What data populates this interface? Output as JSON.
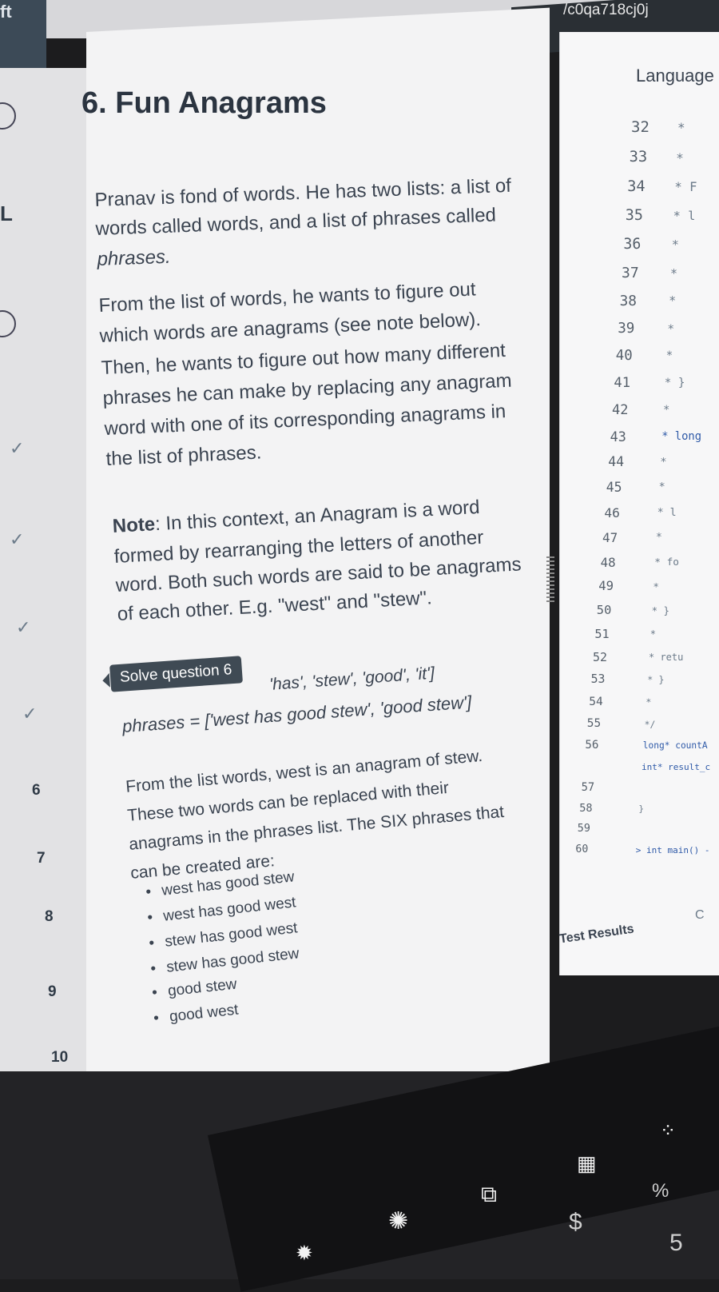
{
  "browser": {
    "tab_fragment": "ft",
    "url_fragment": "/c0qa718cj0j"
  },
  "left_nav": {
    "partial_letters": [
      "L"
    ],
    "items": [
      {
        "number": "6"
      },
      {
        "number": "7"
      },
      {
        "number": "8"
      },
      {
        "number": "9"
      },
      {
        "number": "10"
      }
    ],
    "completed_checks": [
      "✓",
      "✓",
      "✓",
      "✓"
    ]
  },
  "question": {
    "title": "6. Fun Anagrams",
    "intro_lines": [
      "Pranav is fond of words. He has two lists: a list of",
      "words called words, and a list of phrases called",
      "phrases.",
      "From the list of words, he wants to figure out",
      "which words are anagrams (see note below).",
      "Then, he wants to figure out how many different",
      "phrases he can make by replacing any anagram",
      "word with one of its corresponding anagrams in",
      "the list of phrases."
    ],
    "note_label": "Note",
    "note_lines": [
      ": In this context, an Anagram is a word",
      "formed by rearranging the letters of another",
      "word. Both such words are said to be anagrams",
      "of each other. E.g. \"west\" and \"stew\"."
    ],
    "example_words": "'has', 'stew', 'good', 'it']",
    "example_phrases": "phrases = ['west has good stew', 'good stew']",
    "explanation_lines": [
      "From the list words, west is an anagram of stew.",
      "These two words can be replaced with their",
      "anagrams in the phrases list. The SIX phrases that",
      "can be created are:"
    ],
    "phrases": [
      "west has good stew",
      "west has good west",
      "stew has good west",
      "stew has good stew",
      "good stew",
      "good west"
    ]
  },
  "tooltip": {
    "label": "Solve question 6"
  },
  "editor": {
    "language_label": "Language",
    "lines": [
      {
        "n": "32",
        "code": "*"
      },
      {
        "n": "33",
        "code": "*"
      },
      {
        "n": "34",
        "code": "* F"
      },
      {
        "n": "35",
        "code": "* l"
      },
      {
        "n": "36",
        "code": "*"
      },
      {
        "n": "37",
        "code": "*"
      },
      {
        "n": "38",
        "code": "*"
      },
      {
        "n": "39",
        "code": "*"
      },
      {
        "n": "40",
        "code": "*"
      },
      {
        "n": "41",
        "code": "* }"
      },
      {
        "n": "42",
        "code": "*"
      },
      {
        "n": "43",
        "code": "* long"
      },
      {
        "n": "44",
        "code": "*"
      },
      {
        "n": "45",
        "code": "*"
      },
      {
        "n": "46",
        "code": "*      l"
      },
      {
        "n": "47",
        "code": "*"
      },
      {
        "n": "48",
        "code": "*      fo"
      },
      {
        "n": "49",
        "code": "*"
      },
      {
        "n": "50",
        "code": "*      }"
      },
      {
        "n": "51",
        "code": "*"
      },
      {
        "n": "52",
        "code": "*      retu"
      },
      {
        "n": "53",
        "code": "* }"
      },
      {
        "n": "54",
        "code": "*"
      },
      {
        "n": "55",
        "code": "*/"
      },
      {
        "n": "56",
        "code": "long* countA"
      },
      {
        "n": "",
        "code": "int* result_c"
      },
      {
        "n": "57",
        "code": ""
      },
      {
        "n": "58",
        "code": "}"
      },
      {
        "n": "59",
        "code": ""
      },
      {
        "n": "60",
        "code": "> int main() -"
      }
    ],
    "test_results_label": "Test Results",
    "corner_letter": "C"
  },
  "keyboard": {
    "keys": [
      "$",
      "%",
      "5"
    ]
  }
}
